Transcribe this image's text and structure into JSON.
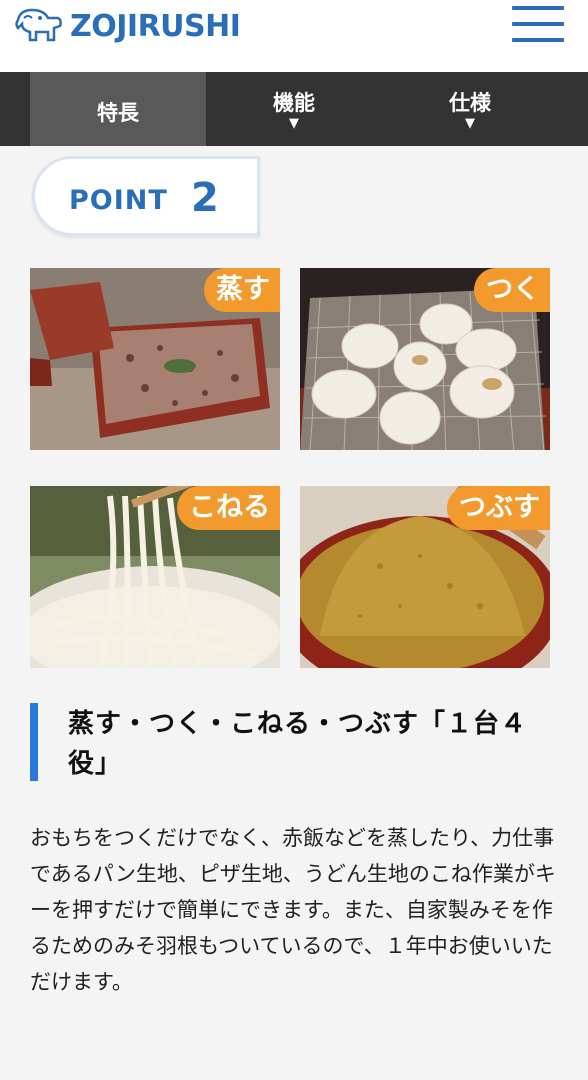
{
  "header": {
    "brand": "ZOJIRUSHI",
    "logo_icon": "elephant-logo-icon",
    "menu_icon": "hamburger-menu-icon",
    "brand_color": "#2a6db8"
  },
  "tabs": [
    {
      "label": "特長",
      "active": true
    },
    {
      "label": "機能",
      "caret": "▼"
    },
    {
      "label": "仕様",
      "caret": "▼"
    }
  ],
  "point": {
    "label": "POINT",
    "number": "2"
  },
  "photos": [
    {
      "tag": "蒸す",
      "subject": "steamed-sekihan-icon"
    },
    {
      "tag": "つく",
      "subject": "grilled-mochi-icon"
    },
    {
      "tag": "こねる",
      "subject": "udon-noodles-icon"
    },
    {
      "tag": "つぶす",
      "subject": "miso-bowl-icon"
    }
  ],
  "tag_color": "#f29a2e",
  "heading": "蒸す・つく・こねる・つぶす「１台４役」",
  "body": "おもちをつくだけでなく、赤飯などを蒸したり、力仕事であるパン生地、ピザ生地、うどん生地のこね作業がキーを押すだけで簡単にできます。また、自家製みそを作るためのみそ羽根もついているので、１年中お使いいただけます。"
}
